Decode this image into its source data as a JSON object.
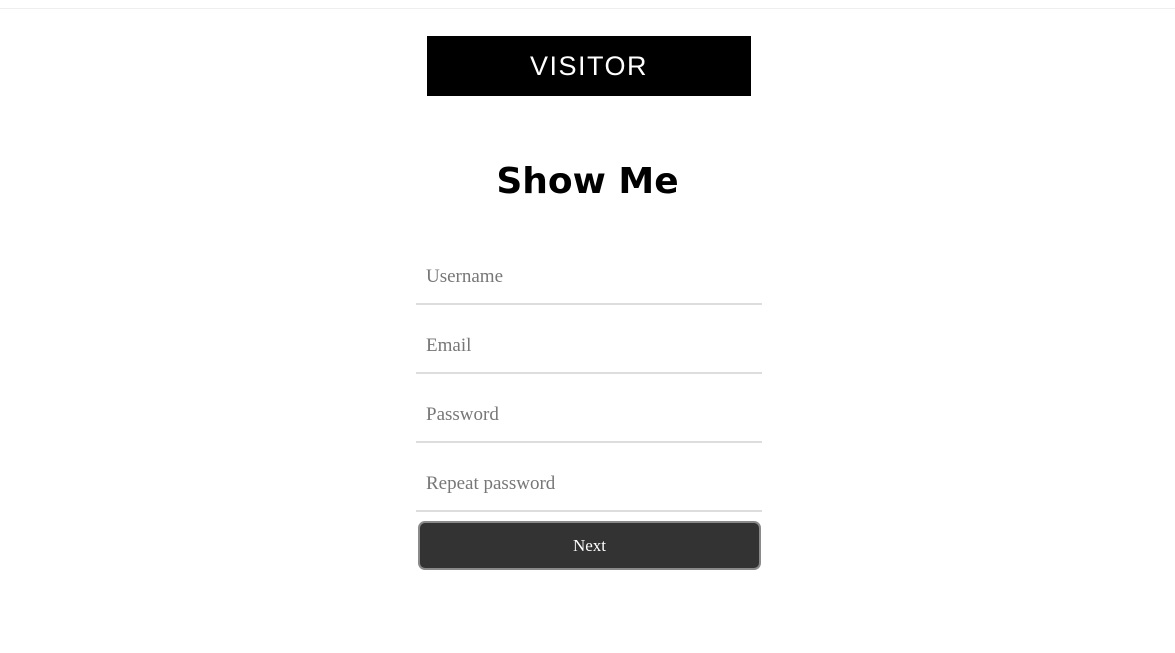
{
  "banner": {
    "label": "VISITOR"
  },
  "heading": {
    "title": "Show Me"
  },
  "form": {
    "username": {
      "placeholder": "Username",
      "value": ""
    },
    "email": {
      "placeholder": "Email",
      "value": ""
    },
    "password": {
      "placeholder": "Password",
      "value": ""
    },
    "repeat_password": {
      "placeholder": "Repeat password",
      "value": ""
    },
    "next_label": "Next"
  },
  "colors": {
    "banner_bg": "#000000",
    "button_bg": "#333333",
    "field_underline": "#dddddd"
  }
}
